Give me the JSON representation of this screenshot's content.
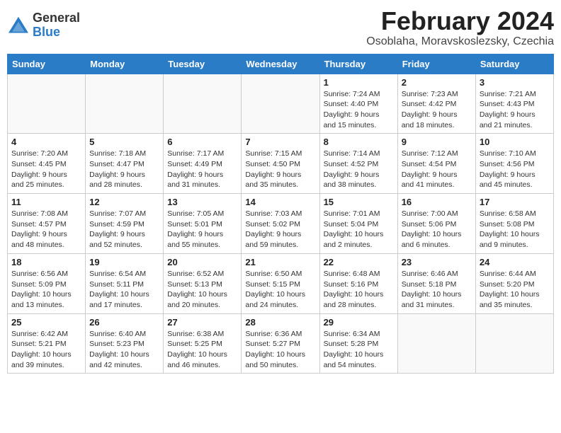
{
  "header": {
    "logo_general": "General",
    "logo_blue": "Blue",
    "month_title": "February 2024",
    "location": "Osoblaha, Moravskoslezsky, Czechia"
  },
  "weekdays": [
    "Sunday",
    "Monday",
    "Tuesday",
    "Wednesday",
    "Thursday",
    "Friday",
    "Saturday"
  ],
  "weeks": [
    [
      {
        "day": "",
        "info": ""
      },
      {
        "day": "",
        "info": ""
      },
      {
        "day": "",
        "info": ""
      },
      {
        "day": "",
        "info": ""
      },
      {
        "day": "1",
        "info": "Sunrise: 7:24 AM\nSunset: 4:40 PM\nDaylight: 9 hours\nand 15 minutes."
      },
      {
        "day": "2",
        "info": "Sunrise: 7:23 AM\nSunset: 4:42 PM\nDaylight: 9 hours\nand 18 minutes."
      },
      {
        "day": "3",
        "info": "Sunrise: 7:21 AM\nSunset: 4:43 PM\nDaylight: 9 hours\nand 21 minutes."
      }
    ],
    [
      {
        "day": "4",
        "info": "Sunrise: 7:20 AM\nSunset: 4:45 PM\nDaylight: 9 hours\nand 25 minutes."
      },
      {
        "day": "5",
        "info": "Sunrise: 7:18 AM\nSunset: 4:47 PM\nDaylight: 9 hours\nand 28 minutes."
      },
      {
        "day": "6",
        "info": "Sunrise: 7:17 AM\nSunset: 4:49 PM\nDaylight: 9 hours\nand 31 minutes."
      },
      {
        "day": "7",
        "info": "Sunrise: 7:15 AM\nSunset: 4:50 PM\nDaylight: 9 hours\nand 35 minutes."
      },
      {
        "day": "8",
        "info": "Sunrise: 7:14 AM\nSunset: 4:52 PM\nDaylight: 9 hours\nand 38 minutes."
      },
      {
        "day": "9",
        "info": "Sunrise: 7:12 AM\nSunset: 4:54 PM\nDaylight: 9 hours\nand 41 minutes."
      },
      {
        "day": "10",
        "info": "Sunrise: 7:10 AM\nSunset: 4:56 PM\nDaylight: 9 hours\nand 45 minutes."
      }
    ],
    [
      {
        "day": "11",
        "info": "Sunrise: 7:08 AM\nSunset: 4:57 PM\nDaylight: 9 hours\nand 48 minutes."
      },
      {
        "day": "12",
        "info": "Sunrise: 7:07 AM\nSunset: 4:59 PM\nDaylight: 9 hours\nand 52 minutes."
      },
      {
        "day": "13",
        "info": "Sunrise: 7:05 AM\nSunset: 5:01 PM\nDaylight: 9 hours\nand 55 minutes."
      },
      {
        "day": "14",
        "info": "Sunrise: 7:03 AM\nSunset: 5:02 PM\nDaylight: 9 hours\nand 59 minutes."
      },
      {
        "day": "15",
        "info": "Sunrise: 7:01 AM\nSunset: 5:04 PM\nDaylight: 10 hours\nand 2 minutes."
      },
      {
        "day": "16",
        "info": "Sunrise: 7:00 AM\nSunset: 5:06 PM\nDaylight: 10 hours\nand 6 minutes."
      },
      {
        "day": "17",
        "info": "Sunrise: 6:58 AM\nSunset: 5:08 PM\nDaylight: 10 hours\nand 9 minutes."
      }
    ],
    [
      {
        "day": "18",
        "info": "Sunrise: 6:56 AM\nSunset: 5:09 PM\nDaylight: 10 hours\nand 13 minutes."
      },
      {
        "day": "19",
        "info": "Sunrise: 6:54 AM\nSunset: 5:11 PM\nDaylight: 10 hours\nand 17 minutes."
      },
      {
        "day": "20",
        "info": "Sunrise: 6:52 AM\nSunset: 5:13 PM\nDaylight: 10 hours\nand 20 minutes."
      },
      {
        "day": "21",
        "info": "Sunrise: 6:50 AM\nSunset: 5:15 PM\nDaylight: 10 hours\nand 24 minutes."
      },
      {
        "day": "22",
        "info": "Sunrise: 6:48 AM\nSunset: 5:16 PM\nDaylight: 10 hours\nand 28 minutes."
      },
      {
        "day": "23",
        "info": "Sunrise: 6:46 AM\nSunset: 5:18 PM\nDaylight: 10 hours\nand 31 minutes."
      },
      {
        "day": "24",
        "info": "Sunrise: 6:44 AM\nSunset: 5:20 PM\nDaylight: 10 hours\nand 35 minutes."
      }
    ],
    [
      {
        "day": "25",
        "info": "Sunrise: 6:42 AM\nSunset: 5:21 PM\nDaylight: 10 hours\nand 39 minutes."
      },
      {
        "day": "26",
        "info": "Sunrise: 6:40 AM\nSunset: 5:23 PM\nDaylight: 10 hours\nand 42 minutes."
      },
      {
        "day": "27",
        "info": "Sunrise: 6:38 AM\nSunset: 5:25 PM\nDaylight: 10 hours\nand 46 minutes."
      },
      {
        "day": "28",
        "info": "Sunrise: 6:36 AM\nSunset: 5:27 PM\nDaylight: 10 hours\nand 50 minutes."
      },
      {
        "day": "29",
        "info": "Sunrise: 6:34 AM\nSunset: 5:28 PM\nDaylight: 10 hours\nand 54 minutes."
      },
      {
        "day": "",
        "info": ""
      },
      {
        "day": "",
        "info": ""
      }
    ]
  ]
}
